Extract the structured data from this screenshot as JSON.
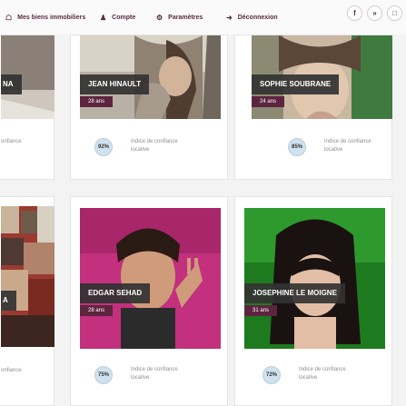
{
  "nav": {
    "properties": "Mes biens immobiliers",
    "account": "Compte",
    "settings": "Paramètres",
    "logout": "Déconnexion",
    "social": [
      "f",
      "»",
      "□"
    ]
  },
  "cards": [
    {
      "name": "",
      "age": "",
      "percent": "",
      "confidence": "onfiance"
    },
    {
      "name": "JEAN HINAULT",
      "age": "28 ans",
      "percent": "92%",
      "confidence": "Indice de confiance locative"
    },
    {
      "name": "SOPHIE SOUBRANE",
      "age": "24 ans",
      "percent": "85%",
      "confidence": "Indice de confiance locative"
    },
    {
      "name": "",
      "age": "",
      "percent": "",
      "confidence": "onfiance"
    },
    {
      "name": "EDGAR SEHAD",
      "age": "28 ans",
      "percent": "75%",
      "confidence": "Indice de confiance locative"
    },
    {
      "name": "JOSEPHINE LE MOIGNE",
      "age": "31 ans",
      "percent": "72%",
      "confidence": "Indice de confiance locative"
    }
  ],
  "partial": {
    "top_name": "NA",
    "bottom_name": "A"
  },
  "colors": {
    "accent": "#5d2440",
    "nav_text": "#5a2a3e",
    "badge": "#cfe2ee"
  }
}
